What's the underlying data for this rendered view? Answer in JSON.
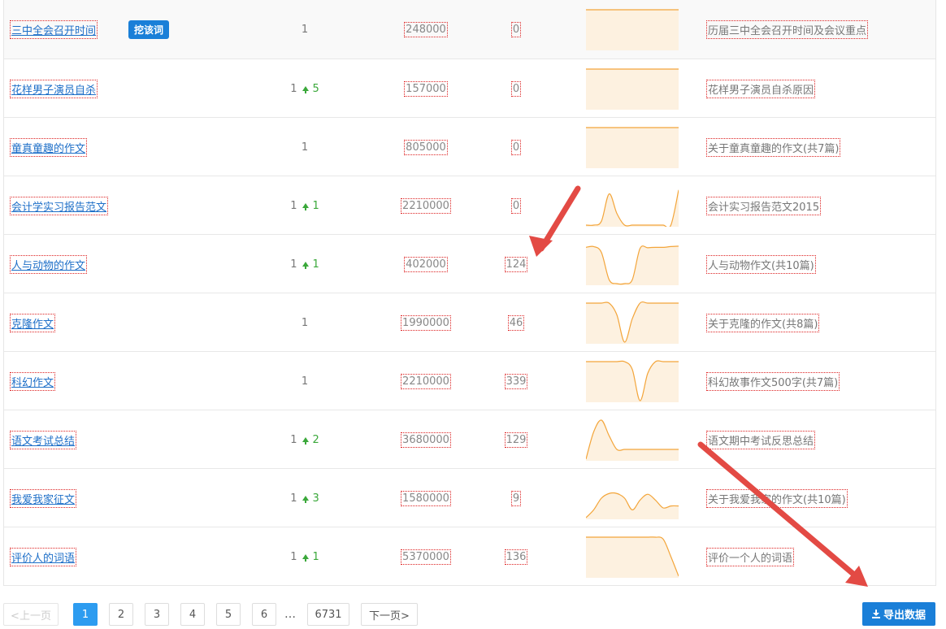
{
  "rows": [
    {
      "keyword": "三中全会召开时间",
      "mine_label": "挖该词",
      "rank": "1",
      "rank_change": "",
      "index": "248000",
      "results": "0",
      "trend": [
        1,
        1,
        1,
        1,
        1,
        1,
        1,
        1,
        1,
        1,
        1,
        1,
        1
      ],
      "related": "历届三中全会召开时间及会议重点"
    },
    {
      "keyword": "花样男子演员自杀",
      "mine_label": "",
      "rank": "1",
      "rank_change": "5",
      "index": "157000",
      "results": "0",
      "trend": [
        1,
        1,
        1,
        1,
        1,
        1,
        1,
        1,
        1,
        1,
        1,
        1,
        1
      ],
      "related": "花样男子演员自杀原因"
    },
    {
      "keyword": "童真童趣的作文",
      "mine_label": "",
      "rank": "1",
      "rank_change": "",
      "index": "805000",
      "results": "0",
      "trend": [
        1,
        1,
        1,
        1,
        1,
        1,
        1,
        1,
        1,
        1,
        1,
        1,
        1
      ],
      "related": "关于童真童趣的作文(共7篇)"
    },
    {
      "keyword": "会计学实习报告范文",
      "mine_label": "",
      "rank": "1",
      "rank_change": "1",
      "index": "2210000",
      "results": "0",
      "trend": [
        0,
        0,
        0.1,
        0.8,
        0.3,
        0,
        0,
        0,
        0,
        0,
        0,
        0,
        0.9
      ],
      "related": "会计实习报告范文2015"
    },
    {
      "keyword": "人与动物的作文",
      "mine_label": "",
      "rank": "1",
      "rank_change": "1",
      "index": "402000",
      "results": "124",
      "trend": [
        0.93,
        0.95,
        0.8,
        0.1,
        0,
        0,
        0.1,
        0.9,
        0.92,
        0.93,
        0.93,
        0.95,
        0.96
      ],
      "related": "人与动物作文(共10篇)"
    },
    {
      "keyword": "克隆作文",
      "mine_label": "",
      "rank": "1",
      "rank_change": "",
      "index": "1990000",
      "results": "46",
      "trend": [
        1,
        1,
        1,
        1,
        0.7,
        0,
        0.6,
        1,
        1,
        1,
        1,
        1,
        1
      ],
      "related": "关于克隆的作文(共8篇)"
    },
    {
      "keyword": "科幻作文",
      "mine_label": "",
      "rank": "1",
      "rank_change": "",
      "index": "2210000",
      "results": "339",
      "trend": [
        1,
        1,
        1,
        1,
        1,
        1,
        0.8,
        0,
        0.7,
        1,
        1,
        1,
        1
      ],
      "related": "科幻故事作文500字(共7篇)"
    },
    {
      "keyword": "语文考试总结",
      "mine_label": "",
      "rank": "1",
      "rank_change": "2",
      "index": "3680000",
      "results": "129",
      "trend": [
        0,
        0.7,
        1,
        0.6,
        0.25,
        0.25,
        0.25,
        0.25,
        0.25,
        0.25,
        0.25,
        0.25,
        0.25
      ],
      "related": "语文期中考试反思总结"
    },
    {
      "keyword": "我爱我家征文",
      "mine_label": "",
      "rank": "1",
      "rank_change": "3",
      "index": "1580000",
      "results": "9",
      "trend": [
        0,
        0.2,
        0.5,
        0.62,
        0.62,
        0.5,
        0.2,
        0.45,
        0.6,
        0.45,
        0.25,
        0.3,
        0.3
      ],
      "related": "关于我爱我家的作文(共10篇)"
    },
    {
      "keyword": "评价人的词语",
      "mine_label": "",
      "rank": "1",
      "rank_change": "1",
      "index": "5370000",
      "results": "136",
      "trend": [
        1,
        1,
        1,
        1,
        1,
        1,
        1,
        1,
        1,
        1,
        0.95,
        0.5,
        0
      ],
      "related": "评价一个人的词语"
    }
  ],
  "pagination": {
    "prev": "<上一页",
    "pages": [
      "1",
      "2",
      "3",
      "4",
      "5",
      "6"
    ],
    "ellipsis": "…",
    "last": "6731",
    "next": "下一页>",
    "current": "1"
  },
  "export_label": "导出数据",
  "colors": {
    "link": "#1e6fc8",
    "accent_button": "#1a7fd8",
    "active_page": "#2d9cf0",
    "rank_up": "#3aa83a",
    "trend_line": "#f3a53a",
    "trend_fill": "#fdf1e0",
    "annotation_arrow": "#e34a44"
  },
  "icons": {
    "rank_up": "up-arrow-icon",
    "export": "download-icon"
  }
}
